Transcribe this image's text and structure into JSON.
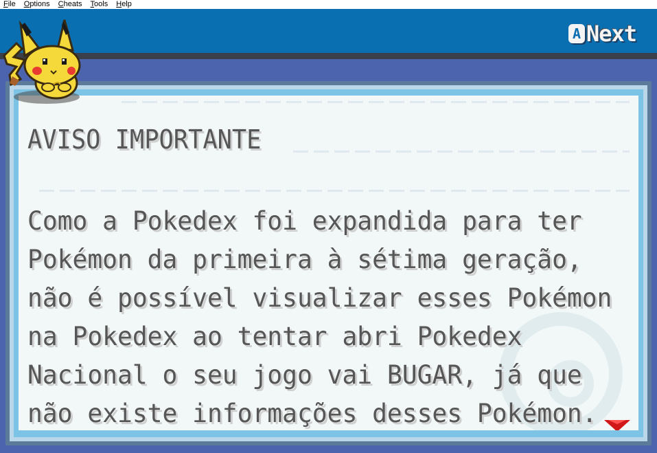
{
  "menu": {
    "items": [
      {
        "label": "File",
        "key": "F",
        "rest": "ile"
      },
      {
        "label": "Options",
        "key": "O",
        "rest": "ptions"
      },
      {
        "label": "Cheats",
        "key": "C",
        "rest": "heats"
      },
      {
        "label": "Tools",
        "key": "T",
        "rest": "ools"
      },
      {
        "label": "Help",
        "key": "H",
        "rest": "elp"
      }
    ]
  },
  "header": {
    "button_icon": "A",
    "next_label": "Next"
  },
  "dialog": {
    "title": "AVISO IMPORTANTE",
    "lines": [
      "Como a Pokedex foi expandida para ter",
      "Pokémon da primeira à sétima geração,",
      "não é possível visualizar esses Pokémon",
      "na Pokedex ao tentar abri Pokedex",
      "Nacional o seu jogo vai BUGAR, já que",
      "não existe informações desses Pokémon."
    ]
  },
  "icons": {
    "mascot": "pikachu-sprite-icon",
    "advance": "next-arrow-icon",
    "a_button": "a-button-icon"
  },
  "colors": {
    "top_bar": "#0a6fb1",
    "background": "#4c63ad",
    "text_box": "#f2f7f7",
    "text": "#565656",
    "arrow": "#d01818"
  }
}
